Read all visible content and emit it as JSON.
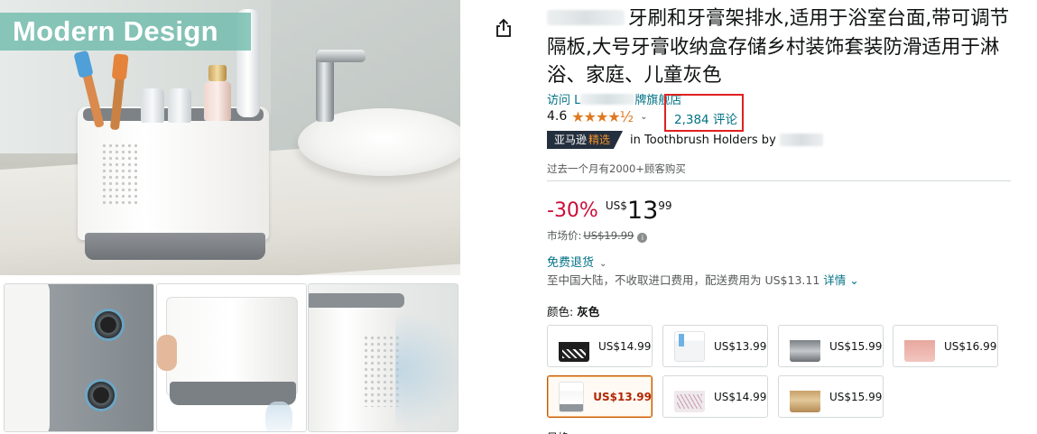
{
  "gallery": {
    "banner_text": "Modern Design",
    "thumbnails": [
      "drainage-holes-closeup",
      "removable-tray-draining",
      "ventilation-holes-side"
    ]
  },
  "product": {
    "title_tail": "牙刷和牙膏架排水,适用于浴室台面,带可调节隔板,大号牙膏收纳盒存储乡村装饰套装防滑适用于淋浴、家庭、儿童灰色",
    "store_prefix": "访问 L",
    "store_suffix": "牌旗舰店",
    "rating": "4.6",
    "stars_display": "★★★★½",
    "reviews": "2,384 评论",
    "badge_label": "亚马逊",
    "badge_pick": "精选",
    "badge_text": "in Toothbrush Holders by",
    "bought_text": "过去一个月有2000+顾客购买",
    "discount": "-30%",
    "currency": "US$",
    "price_whole": "13",
    "price_fraction": "99",
    "list_price_label": "市场价:",
    "list_price": "US$19.99",
    "returns_text": "免费退货",
    "shipping_text": "至中国大陆，不收取进口费用，配送费用为 US$13.11",
    "shipping_detail": "详情",
    "color_label": "颜色:",
    "color_value": "灰色",
    "next_section_label": "风格"
  },
  "swatches": [
    {
      "variant": "black",
      "price": "US$14.99",
      "selected": false
    },
    {
      "variant": "white",
      "price": "US$13.99",
      "selected": false
    },
    {
      "variant": "steel",
      "price": "US$15.99",
      "selected": false
    },
    {
      "variant": "pink",
      "price": "US$16.99",
      "selected": false
    },
    {
      "variant": "greywhite",
      "price": "US$13.99",
      "selected": true
    },
    {
      "variant": "marble",
      "price": "US$14.99",
      "selected": false
    },
    {
      "variant": "gold",
      "price": "US$15.99",
      "selected": false
    }
  ],
  "icons": {
    "share": "share-icon",
    "info": "info-icon",
    "chevron": "chevron-down-icon"
  },
  "colors": {
    "link": "#007185",
    "discount": "#cc0c39",
    "star": "#de7921",
    "highlight_box": "#e02020",
    "selected_border": "#c45500",
    "banner": "#6cbaaa"
  }
}
